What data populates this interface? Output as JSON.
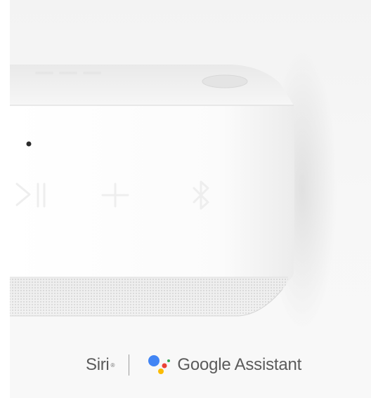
{
  "brands": {
    "siri": "Siri",
    "siri_mark": "®",
    "google": "Google",
    "assistant": "Assistant"
  },
  "speaker": {
    "controls": [
      "play-pause-icon",
      "plus-icon",
      "bluetooth-icon"
    ],
    "color": "#ffffff"
  },
  "google_colors": [
    "#4285F4",
    "#EA4335",
    "#FBBC05",
    "#34A853"
  ]
}
